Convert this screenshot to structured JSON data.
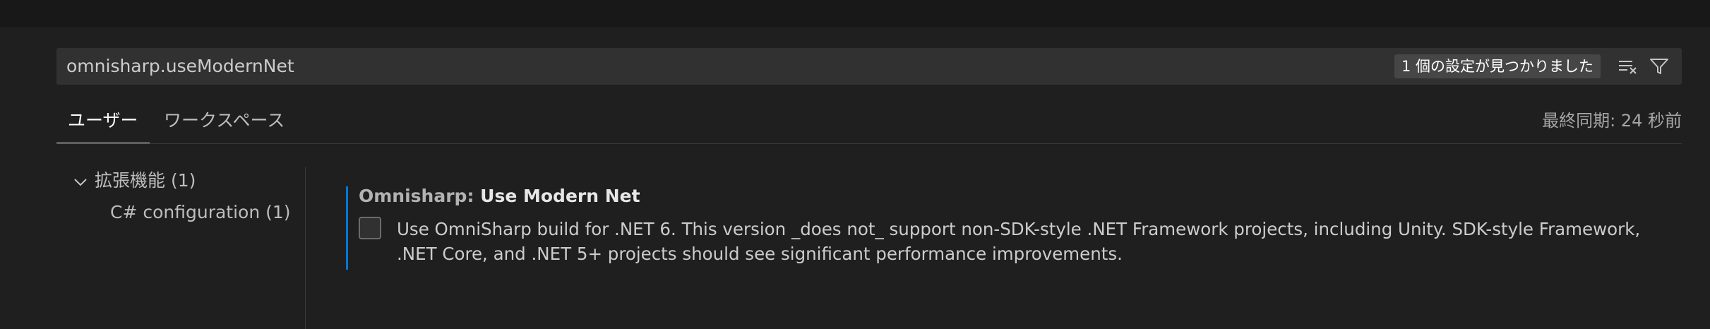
{
  "search": {
    "value": "omnisharp.useModernNet",
    "result_count": "1 個の設定が見つかりました",
    "clear_icon": "clear-filter-icon",
    "filter_icon": "filter-icon"
  },
  "tabs": [
    {
      "label": "ユーザー",
      "active": true
    },
    {
      "label": "ワークスペース",
      "active": false
    }
  ],
  "last_sync": "最終同期: 24 秒前",
  "toc": {
    "group": {
      "label": "拡張機能 (1)",
      "expanded": true,
      "icon": "chevron-down-icon"
    },
    "items": [
      {
        "label": "C# configuration (1)"
      }
    ]
  },
  "setting": {
    "category": "Omnisharp: ",
    "name": "Use Modern Net",
    "checked": false,
    "description": "Use OmniSharp build for .NET 6. This version _does not_ support non-SDK-style .NET Framework projects, including Unity. SDK-style Framework, .NET Core, and .NET 5+ projects should see significant performance improvements."
  },
  "colors": {
    "background": "#1f1f1f",
    "input_background": "#313131",
    "accent": "#0078d4",
    "badge_background": "#464646"
  }
}
